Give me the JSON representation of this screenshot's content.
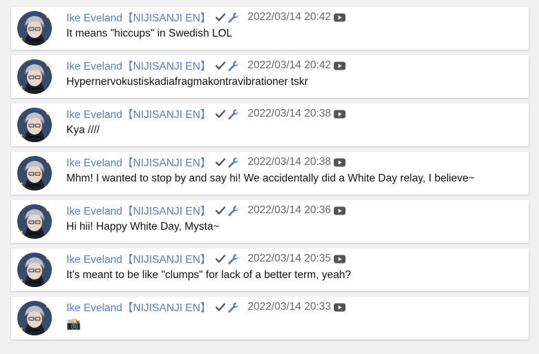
{
  "colors": {
    "author": "#5b7ec9",
    "timestamp": "#666666",
    "message": "#111111",
    "badge": "#555555",
    "page_background": "#f0f0f0"
  },
  "icons": {
    "verified": "checkmark-icon",
    "moderator": "wrench-icon",
    "platform": "youtube-icon"
  },
  "messages": [
    {
      "author": "Ike Eveland【NIJISANJI EN】",
      "timestamp": "2022/03/14 20:42",
      "text": "It means \"hiccups\" in Swedish LOL"
    },
    {
      "author": "Ike Eveland【NIJISANJI EN】",
      "timestamp": "2022/03/14 20:42",
      "text": "Hypernervokustiskadiafragmakontravibrationer tskr"
    },
    {
      "author": "Ike Eveland【NIJISANJI EN】",
      "timestamp": "2022/03/14 20:38",
      "text": "Kya ////"
    },
    {
      "author": "Ike Eveland【NIJISANJI EN】",
      "timestamp": "2022/03/14 20:38",
      "text": "Mhm! I wanted to stop by and say hi! We accidentally did a White Day relay, I believe~"
    },
    {
      "author": "Ike Eveland【NIJISANJI EN】",
      "timestamp": "2022/03/14 20:36",
      "text": "Hi hii! Happy White Day, Mysta~"
    },
    {
      "author": "Ike Eveland【NIJISANJI EN】",
      "timestamp": "2022/03/14 20:35",
      "text": "It's meant to be like \"clumps\" for lack of a better term, yeah?"
    },
    {
      "author": "Ike Eveland【NIJISANJI EN】",
      "timestamp": "2022/03/14 20:33",
      "text": "📸"
    }
  ]
}
